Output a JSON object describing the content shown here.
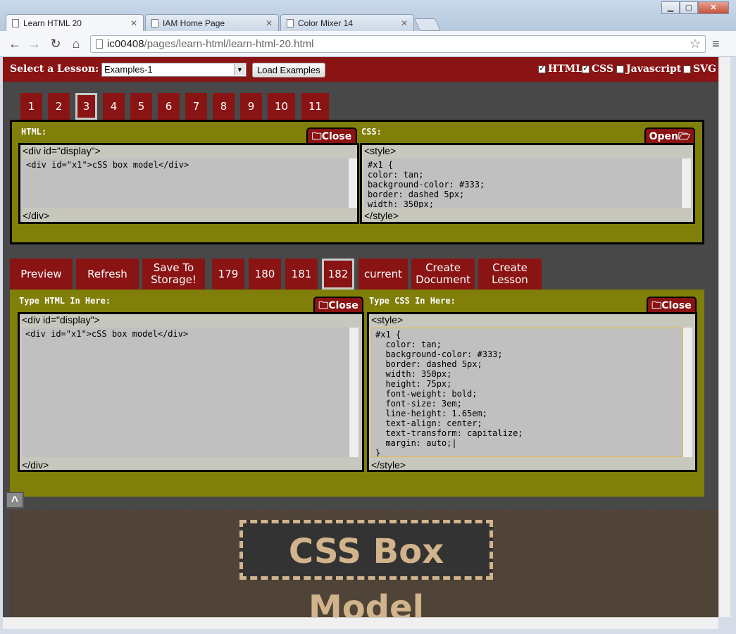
{
  "browser": {
    "tabs": [
      {
        "label": "Learn HTML 20"
      },
      {
        "label": "IAM Home Page"
      },
      {
        "label": "Color Mixer 14"
      }
    ],
    "url_host": "ic00408",
    "url_path": "/pages/learn-html/learn-html-20.html"
  },
  "lesson_bar": {
    "label": "Select a Lesson:",
    "selected_lesson": "Examples-1",
    "load_button": "Load Examples",
    "toggles": [
      {
        "label": "HTML",
        "checked": true
      },
      {
        "label": "CSS",
        "checked": true
      },
      {
        "label": "Javascript",
        "checked": false
      },
      {
        "label": "SVG",
        "checked": false
      }
    ]
  },
  "example_tabs": [
    "1",
    "2",
    "3",
    "4",
    "5",
    "6",
    "7",
    "8",
    "9",
    "10",
    "11"
  ],
  "example_panel": {
    "html_label": "HTML:",
    "css_label": "CSS:",
    "close_label": "Close",
    "open_label": "Open",
    "html_head": "<div id=\"display\">",
    "html_body": "<div id=\"x1\">cSS box model</div>",
    "html_foot": "</div>",
    "css_head": "<style>",
    "css_body": "#x1 {\ncolor: tan;\nbackground-color: #333;\nborder: dashed 5px;\nwidth: 350px;",
    "css_foot": "</style>"
  },
  "action_buttons": {
    "preview": "Preview",
    "refresh": "Refresh",
    "save": "Save To\nStorage!",
    "versions": [
      "179",
      "180",
      "181",
      "182"
    ],
    "current": "current",
    "create_document": "Create\nDocument",
    "create_lesson": "Create\nLesson"
  },
  "edit_panel": {
    "html_label": "Type HTML In Here:",
    "css_label": "Type CSS In Here:",
    "close_label": "Close",
    "html_head": "<div id=\"display\">",
    "html_body": "<div id=\"x1\">cSS box model</div>",
    "html_foot": "</div>",
    "css_head": "<style>",
    "css_body": "#x1 {\n  color: tan;\n  background-color: #333;\n  border: dashed 5px;\n  width: 350px;\n  height: 75px;\n  font-weight: bold;\n  font-size: 3em;\n  line-height: 1.65em;\n  text-align: center;\n  text-transform: capitalize;\n  margin: auto;|\n}",
    "css_foot": "</style>"
  },
  "collapse_label": "^",
  "output": {
    "text": "cSS box model"
  },
  "colors": {
    "accent_red": "#8a1313",
    "panel_olive": "#7f7f0a",
    "page_bg": "#484848",
    "output_bg": "#4f4437",
    "box_text": "tan"
  }
}
